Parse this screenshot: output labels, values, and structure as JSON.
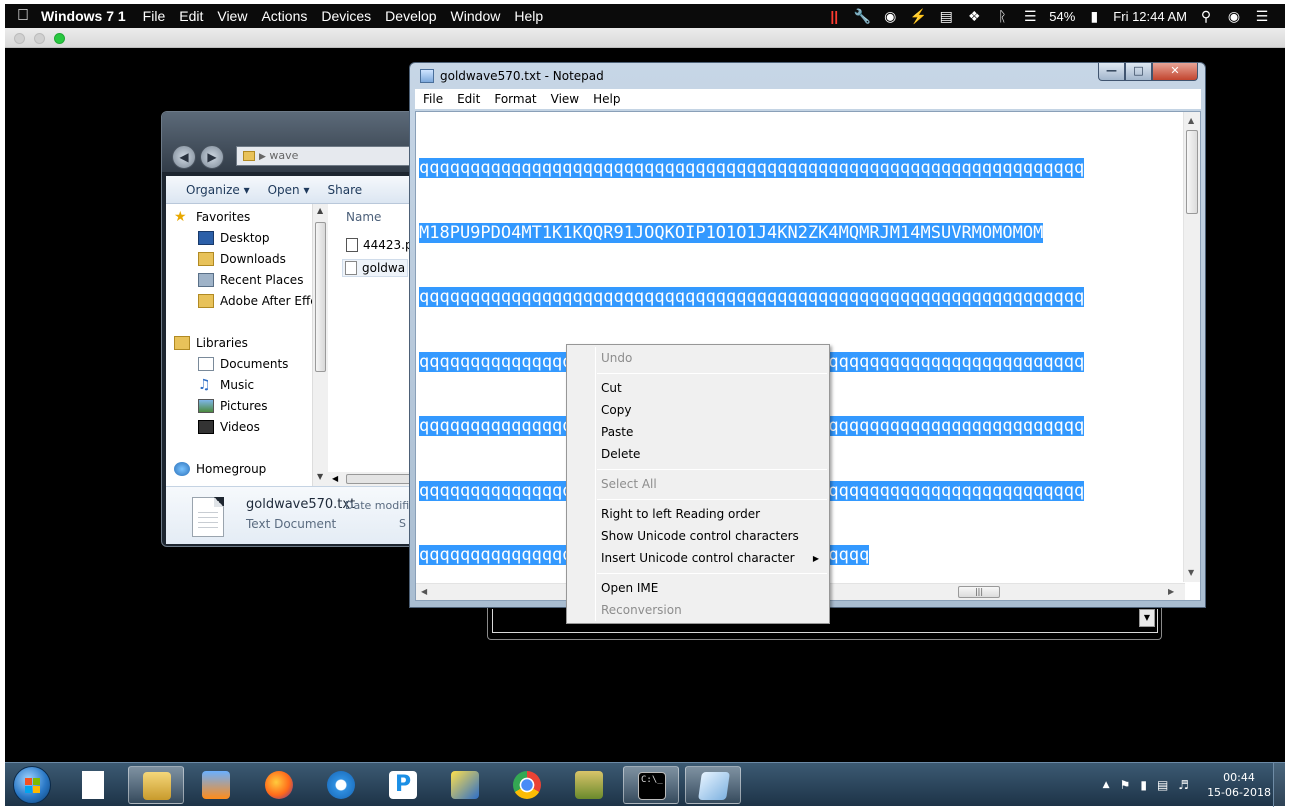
{
  "mac_menubar": {
    "app": "Windows 7 1",
    "items": [
      "File",
      "Edit",
      "View",
      "Actions",
      "Devices",
      "Develop",
      "Window",
      "Help"
    ],
    "battery": "54%",
    "clock": "Fri 12:44 AM"
  },
  "explorer": {
    "address": "wave",
    "toolbar": {
      "organize": "Organize ▾",
      "open": "Open ▾",
      "share": "Share"
    },
    "nav": {
      "favorites": "Favorites",
      "desktop": "Desktop",
      "downloads": "Downloads",
      "recent": "Recent Places",
      "adobe": "Adobe After Effe",
      "libraries": "Libraries",
      "documents": "Documents",
      "music": "Music",
      "pictures": "Pictures",
      "videos": "Videos",
      "homegroup": "Homegroup"
    },
    "files_header": "Name",
    "files": [
      "44423.p",
      "goldwa"
    ],
    "status": {
      "name": "goldwave570.txt",
      "type": "Text Document",
      "date_label": "Date modifi",
      "size_label": "S"
    }
  },
  "notepad": {
    "title": "goldwave570.txt - Notepad",
    "menu": [
      "File",
      "Edit",
      "Format",
      "View",
      "Help"
    ],
    "lines": [
      "qqqqqqqqqqqqqqqqqqqqqqqqqqqqqqqqqqqqqqqqqqqqqqqqqqqqqqqqqqqqqqqqq",
      "M18PU9PDO4MT1K1KQQR91JOQKOIP1O1O1J4KN2ZK4MQMRJM14MSUVRMOMOMOM",
      "qqqqqqqqqqqqqqqqqqqqqqqqqqqqqqqqqqqqqqqqqqqqqqqqqqqqqqqqqqqqqqqqq",
      "qqqqqqqqqqqqqqqqqqqqqqqqqqqqqqqqqqqqqqqqqqqqqqqqqqqqqqqqqqqqqqqqq",
      "qqqqqqqqqqqqqqqqqqqqqqqqqqqqqqqqqqqqqqqqqqqqqqqqqqqqqqqqqqqqqqqqq",
      "qqqqqqqqqqqqqqqqqqqqqqqqqqqqqqqqqqqqqqqqqqqqqqqqqqqqqqqqqqqqqqqqq",
      "qqqqqqqqqqqqqqqqqqqqqqqqqqqqqqqqqqqqqqqqqqqq"
    ]
  },
  "context_menu": {
    "undo": "Undo",
    "cut": "Cut",
    "copy": "Copy",
    "paste": "Paste",
    "delete": "Delete",
    "select_all": "Select All",
    "rtl": "Right to left Reading order",
    "show_unicode": "Show Unicode control characters",
    "insert_unicode": "Insert Unicode control character",
    "open_ime": "Open IME",
    "reconversion": "Reconversion"
  },
  "taskbar": {
    "time": "00:44",
    "date": "15-06-2018"
  }
}
